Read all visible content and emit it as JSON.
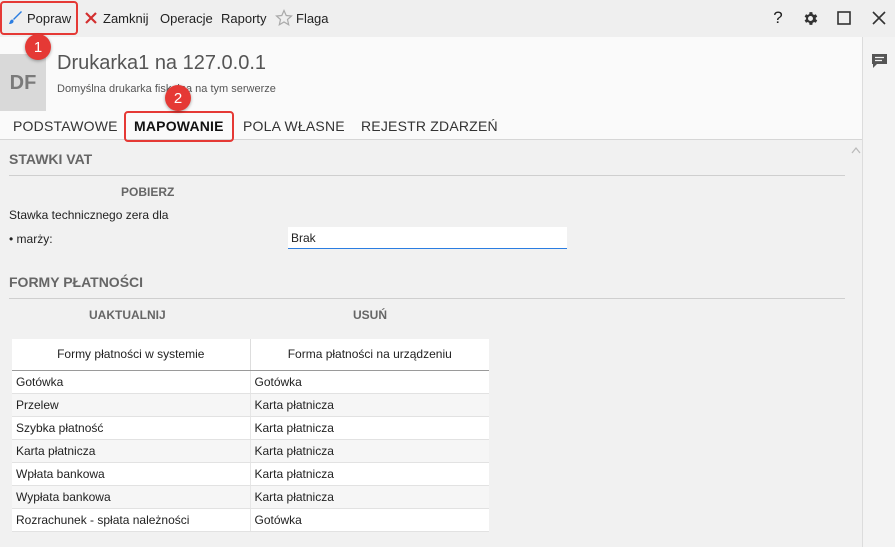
{
  "toolbar": {
    "edit_label": "Popraw",
    "close_label": "Zamknij",
    "operations_label": "Operacje",
    "reports_label": "Raporty",
    "flag_label": "Flaga",
    "help_label": "?"
  },
  "annotations": {
    "step1": "1",
    "step2": "2"
  },
  "header": {
    "avatar": "DF",
    "title": "Drukarka1 na 127.0.0.1",
    "subtitle": "Domyślna drukarka fiskalna na tym serwerze"
  },
  "tabs": [
    {
      "label": "PODSTAWOWE"
    },
    {
      "label": "MAPOWANIE"
    },
    {
      "label": "POLA WŁASNE"
    },
    {
      "label": "REJESTR ZDARZEŃ"
    }
  ],
  "vat": {
    "title": "STAWKI VAT",
    "fetch_label": "POBIERZ",
    "description": "Stawka technicznego zera dla",
    "margin_label": "• marży:",
    "margin_value": "Brak"
  },
  "payments": {
    "title": "FORMY PŁATNOŚCI",
    "update_label": "UAKTUALNIJ",
    "delete_label": "USUŃ",
    "columns": [
      "Formy płatności w systemie",
      "Forma płatności na urządzeniu"
    ],
    "rows": [
      [
        "Gotówka",
        "Gotówka"
      ],
      [
        "Przelew",
        "Karta płatnicza"
      ],
      [
        "Szybka płatność",
        "Karta płatnicza"
      ],
      [
        "Karta płatnicza",
        "Karta płatnicza"
      ],
      [
        "Wpłata bankowa",
        "Karta płatnicza"
      ],
      [
        "Wypłata bankowa",
        "Karta płatnicza"
      ],
      [
        "Rozrachunek - spłata należności",
        "Gotówka"
      ]
    ]
  },
  "colors": {
    "highlight": "#e53935",
    "accent": "#2b7de1",
    "close_red": "#d32f2f"
  }
}
